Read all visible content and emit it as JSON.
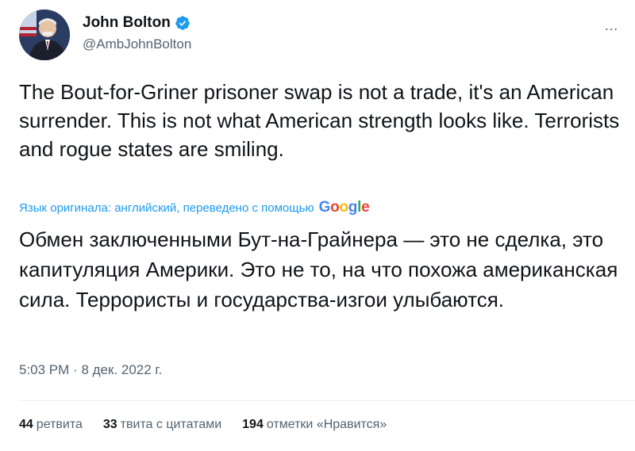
{
  "author": {
    "name": "John Bolton",
    "handle": "@AmbJohnBolton"
  },
  "more_icon": "…",
  "tweet_text": "The Bout-for-Griner prisoner swap is not a trade, it's an American surrender. This is not what American strength looks like. Terrorists and rogue states are smiling.",
  "translation": {
    "notice": "Язык оригинала: английский, переведено с помощью",
    "google_letters": [
      {
        "char": "G",
        "color": "#4285F4"
      },
      {
        "char": "o",
        "color": "#EA4335"
      },
      {
        "char": "o",
        "color": "#FBBC05"
      },
      {
        "char": "g",
        "color": "#4285F4"
      },
      {
        "char": "l",
        "color": "#34A853"
      },
      {
        "char": "e",
        "color": "#EA4335"
      }
    ],
    "text": "Обмен заключенными Бут-на-Грайнера — это не сделка, это капитуляция Америки. Это не то, на что похожа американская сила. Террористы и государства-изгои улыбаются."
  },
  "meta": {
    "time": "5:03 PM",
    "separator": "·",
    "date": "8 дек. 2022 г."
  },
  "stats": {
    "retweets_count": "44",
    "retweets_label": "ретвита",
    "quotes_count": "33",
    "quotes_label": "твита с цитатами",
    "likes_count": "194",
    "likes_label": "отметки «Нравится»"
  },
  "colors": {
    "accent": "#1d9bf0",
    "text": "#0f1419",
    "muted": "#536471"
  }
}
